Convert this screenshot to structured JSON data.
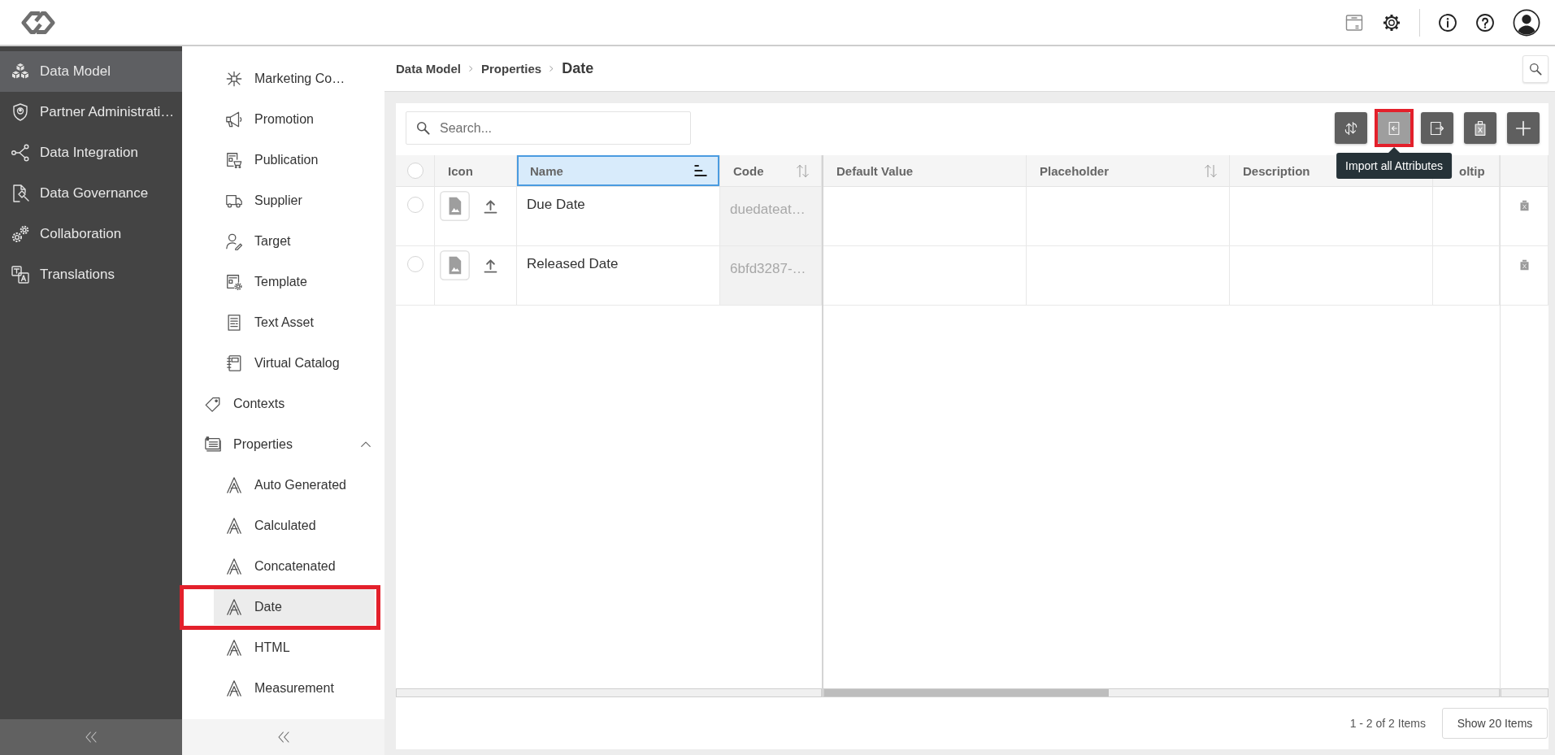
{
  "main_nav": {
    "items": [
      {
        "label": "Data Model",
        "selected": true
      },
      {
        "label": "Partner Administrati…",
        "selected": false
      },
      {
        "label": "Data Integration",
        "selected": false
      },
      {
        "label": "Data Governance",
        "selected": false
      },
      {
        "label": "Collaboration",
        "selected": false
      },
      {
        "label": "Translations",
        "selected": false
      }
    ]
  },
  "sub_nav": {
    "items": [
      {
        "children": [
          {
            "label": "Marketing Co…",
            "selected": false,
            "highlighted": false
          },
          {
            "label": "Promotion",
            "selected": false,
            "highlighted": false
          },
          {
            "label": "Publication",
            "selected": false,
            "highlighted": false
          },
          {
            "label": "Supplier",
            "selected": false,
            "highlighted": false
          },
          {
            "label": "Target",
            "selected": false,
            "highlighted": false
          },
          {
            "label": "Template",
            "selected": false,
            "highlighted": false
          },
          {
            "label": "Text Asset",
            "selected": false,
            "highlighted": false
          },
          {
            "label": "Virtual Catalog",
            "selected": false,
            "highlighted": false
          }
        ]
      },
      {
        "label": "Contexts",
        "selected": false,
        "highlighted": false
      },
      {
        "label": "Properties",
        "selected": false,
        "highlighted": false,
        "expanded": true,
        "children": [
          {
            "label": "Auto Generated",
            "selected": false,
            "highlighted": false
          },
          {
            "label": "Calculated",
            "selected": false,
            "highlighted": false
          },
          {
            "label": "Concatenated",
            "selected": false,
            "highlighted": false
          },
          {
            "label": "Date",
            "selected": true,
            "highlighted": true
          },
          {
            "label": "HTML",
            "selected": false,
            "highlighted": false
          },
          {
            "label": "Measurement",
            "selected": false,
            "highlighted": false
          }
        ]
      }
    ]
  },
  "breadcrumb": [
    "Data Model",
    "Properties",
    "Date"
  ],
  "search": {
    "placeholder": "Search..."
  },
  "toolbar": {
    "buttons": [
      {
        "hovered": false,
        "highlighted": false
      },
      {
        "hovered": true,
        "highlighted": true,
        "tooltip": "Import all Attributes"
      },
      {
        "hovered": false,
        "highlighted": false
      },
      {
        "hovered": false,
        "highlighted": false
      },
      {
        "hovered": false,
        "highlighted": false
      }
    ]
  },
  "table": {
    "columns": [
      {
        "kind": "select",
        "frozen": true,
        "checked": false
      },
      {
        "kind": "image",
        "label": "Icon",
        "frozen": true,
        "selected": false,
        "sortable": false,
        "sorted": false
      },
      {
        "kind": "name",
        "label": "Name",
        "frozen": true,
        "selected": true,
        "sortable": true,
        "sorted": true
      },
      {
        "kind": "code",
        "label": "Code",
        "frozen": true,
        "selected": false,
        "sortable": true,
        "sorted": false
      },
      {
        "kind": "text",
        "label": "Default Value",
        "frozen": false,
        "selected": false,
        "sortable": false,
        "sorted": false
      },
      {
        "kind": "text",
        "label": "Placeholder",
        "frozen": false,
        "selected": false,
        "sortable": true,
        "sorted": false
      },
      {
        "kind": "text",
        "label": "Description",
        "frozen": false,
        "selected": false,
        "sortable": false,
        "sorted": false
      },
      {
        "kind": "text",
        "label": "oltip",
        "frozen": false,
        "selected": false,
        "sortable": false,
        "sorted": false
      },
      {
        "kind": "actions",
        "frozen": true
      }
    ],
    "rows": [
      {
        "selected": false,
        "name": "Due Date",
        "code": "duedateat…"
      },
      {
        "selected": false,
        "name": "Released Date",
        "code": "6bfd3287-…"
      }
    ]
  },
  "pager": {
    "summary": "1 - 2 of 2 Items",
    "page_size_button": "Show 20 Items"
  }
}
